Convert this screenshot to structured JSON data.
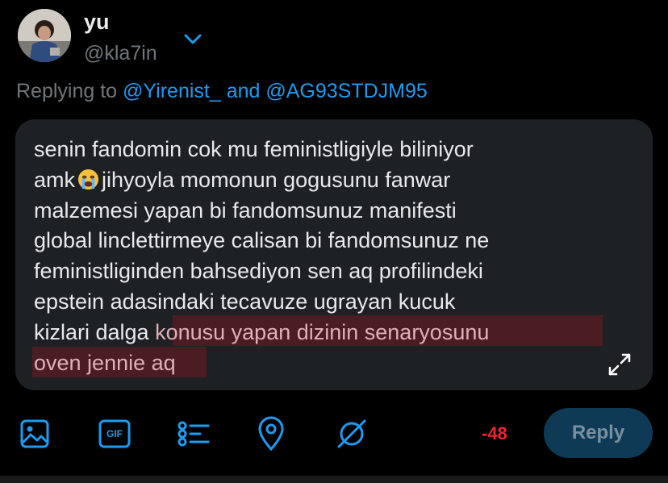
{
  "user": {
    "name": "yu",
    "handle": "@kla7in"
  },
  "replying": {
    "prefix": "Replying to",
    "mention_1": "@Yirenist_",
    "conjunction": "and",
    "mention_2": "@AG93STDJM95"
  },
  "composer": {
    "text_lines": [
      "senin fandomin cok mu feministligiyle biliniyor",
      "jihyoyla momonun gogusunu fanwar",
      "malzemesi yapan bi fandomsunuz manifesti",
      "global linclettirmeye calisan bi fandomsunuz ne",
      "feministliginden bahsediyon sen aq profilindeki",
      "epstein adasindaki tecavuze ugrayan kucuk",
      "kizlari dalga"
    ],
    "line2_prefix": "amk",
    "emoji": "loudly-crying-face",
    "highlighted_line_1": "konusu yapan dizinin senaryosunu",
    "highlighted_line_2": "oven jennie aq",
    "highlight_color": "#4a1d22"
  },
  "toolbar": {
    "icons": [
      "image-icon",
      "gif-icon",
      "poll-icon",
      "location-icon",
      "circle-slash-icon"
    ],
    "gif_label": "GIF",
    "char_count": "-48",
    "reply_label": "Reply"
  },
  "colors": {
    "accent": "#1d9bf0",
    "error": "#f4212e",
    "reply_button_disabled": "#0e3a56"
  }
}
